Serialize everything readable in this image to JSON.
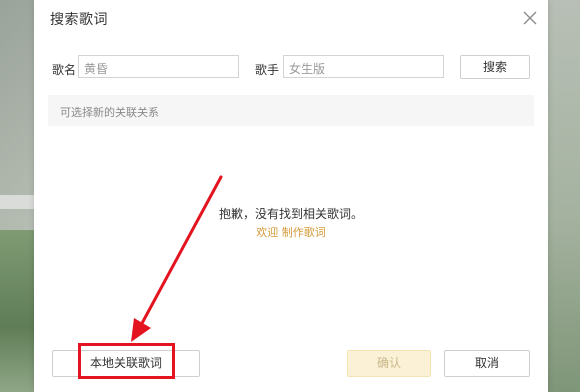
{
  "dialog": {
    "title": "搜索歌词",
    "close_icon": "close-icon"
  },
  "search": {
    "song_label": "歌名",
    "song_value": "黄昏",
    "singer_label": "歌手",
    "singer_value": "女生版",
    "search_button": "搜索"
  },
  "hint": "可选择新的关联关系",
  "empty": {
    "message": "抱歉，没有找到相关歌词。",
    "link_welcome": "欢迎",
    "link_make": "制作歌词"
  },
  "footer": {
    "local_button": "本地关联歌词",
    "confirm_button": "确认",
    "cancel_button": "取消"
  },
  "colors": {
    "annotation": "#e3141f",
    "link": "#d59a3a",
    "confirm_bg": "#fbf1d6"
  }
}
